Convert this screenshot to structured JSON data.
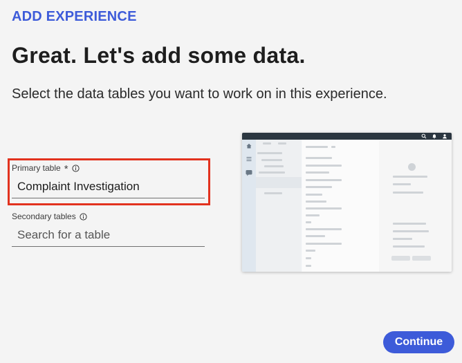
{
  "header": {
    "eyebrow": "ADD EXPERIENCE",
    "title": "Great. Let's add some data.",
    "subtitle": "Select the data tables you want to work on in this experience."
  },
  "primary_table": {
    "label": "Primary table",
    "required_marker": "*",
    "value": "Complaint Investigation",
    "info_icon": "info-icon",
    "highlight_color": "#e2321e"
  },
  "secondary_tables": {
    "label": "Secondary tables",
    "placeholder": "Search for a table",
    "info_icon": "info-icon"
  },
  "preview": {
    "icons": [
      "search-icon",
      "bell-icon",
      "user-icon",
      "home-icon",
      "menu-icon",
      "chat-icon"
    ]
  },
  "footer": {
    "continue_label": "Continue"
  },
  "colors": {
    "accent": "#3d5bd9",
    "background": "#f4f4f4"
  }
}
